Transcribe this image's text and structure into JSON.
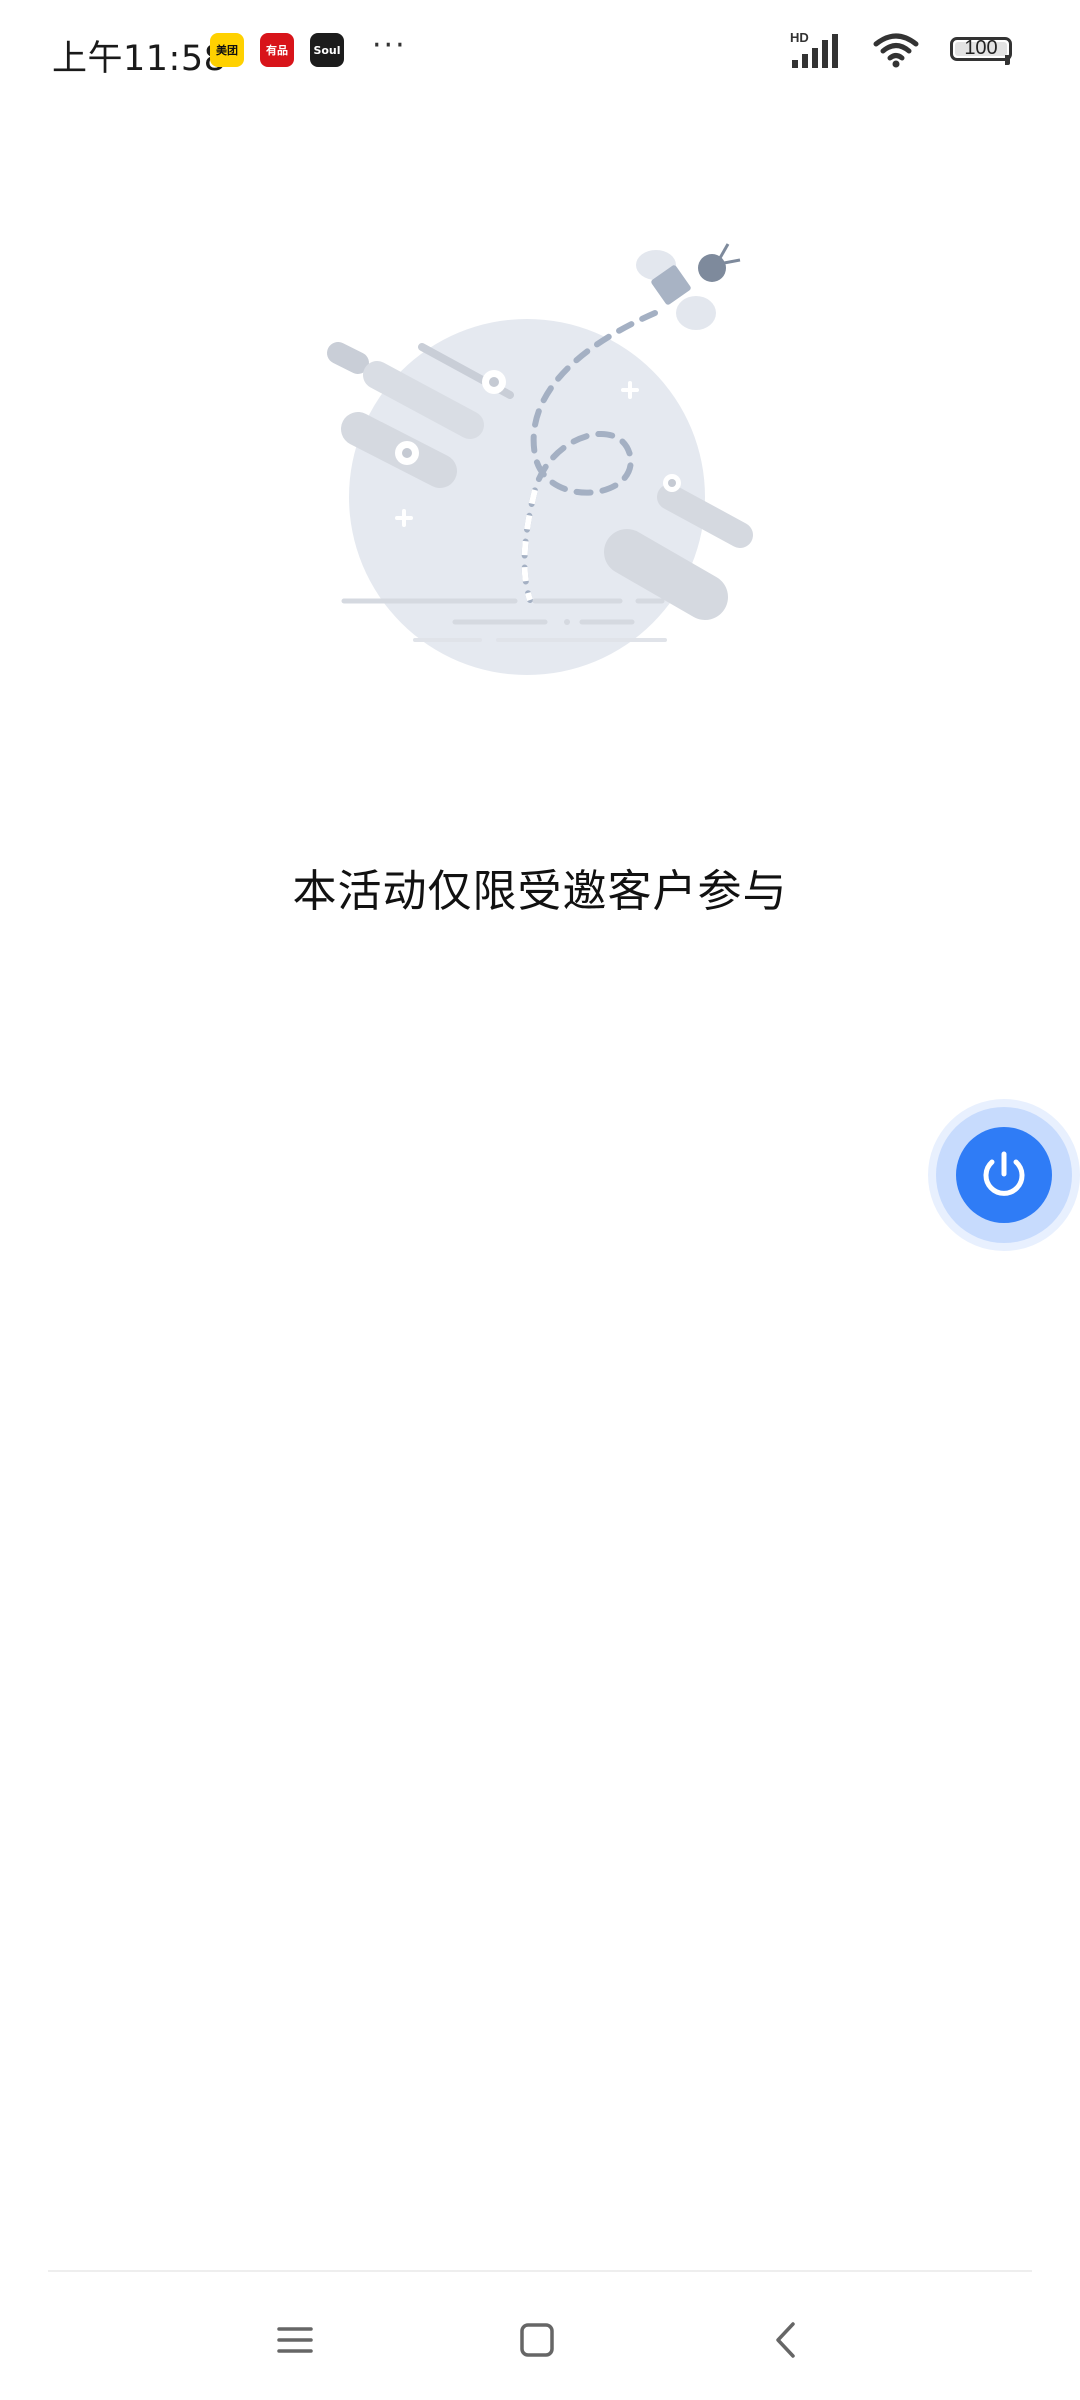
{
  "status_bar": {
    "time": "上午11:58",
    "notifications": [
      {
        "name": "meituan",
        "label": "美团"
      },
      {
        "name": "youpin",
        "label": "有品"
      },
      {
        "name": "soul",
        "label": "Soul"
      }
    ],
    "more": "···",
    "network": "HD",
    "battery": "100"
  },
  "main": {
    "message": "本活动仅限受邀客户参与"
  },
  "fab": {
    "icon": "power-icon",
    "color": "#2f7cf6"
  },
  "nav_bar": {
    "buttons": [
      "menu-icon",
      "home-icon",
      "back-icon"
    ]
  }
}
